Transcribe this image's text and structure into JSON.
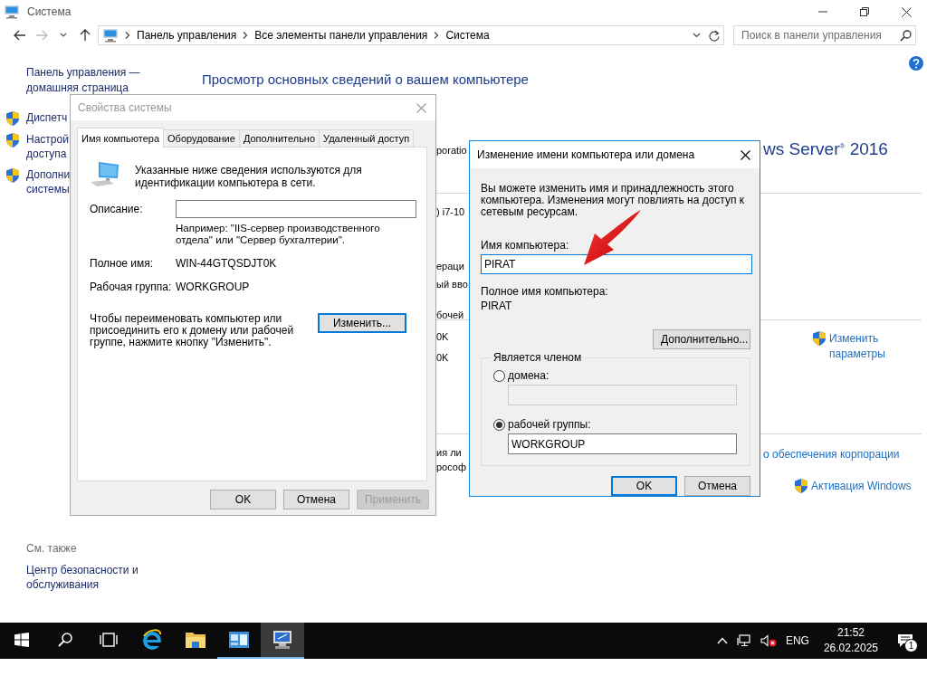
{
  "window": {
    "title": "Система"
  },
  "address_bar": {
    "path": [
      "Панель управления",
      "Все элементы панели управления",
      "Система"
    ]
  },
  "search": {
    "placeholder": "Поиск в панели управления"
  },
  "sidebar": {
    "home_link": "Панель управления — домашняя страница",
    "items": [
      {
        "lines": [
          "Диспетч"
        ]
      },
      {
        "lines": [
          "Настрой",
          "доступа"
        ]
      },
      {
        "lines": [
          "Дополни",
          "системы"
        ]
      }
    ],
    "see_also": {
      "title": "См. также",
      "links": [
        "Центр безопасности и обслуживания"
      ]
    }
  },
  "main": {
    "heading": "Просмотр основных сведений о вашем компьютере",
    "edition": "ws Server$^{®}$ 2016",
    "fragments": [
      "poratio",
      ") i7-10",
      "ераци",
      "ый вво",
      "бочей",
      "0K",
      "0K",
      "ия ли",
      "рософ"
    ],
    "links": [
      {
        "text": "Изменить параметры",
        "shield": true
      },
      {
        "text": "о обеспечения корпорации",
        "shield": false
      },
      {
        "text": "Активация Windows",
        "shield": true
      }
    ]
  },
  "system_properties": {
    "title": "Свойства системы",
    "tabs": [
      {
        "label": "Имя компьютера",
        "selected": true
      },
      {
        "label": "Оборудование",
        "selected": false
      },
      {
        "label": "Дополнительно",
        "selected": false
      },
      {
        "label": "Удаленный доступ",
        "selected": false
      }
    ],
    "intro": "Указанные ниже сведения используются для идентификации компьютера в сети.",
    "description_label": "Описание:",
    "description_hint": "Например: \"IIS-сервер производственного отдела\" или \"Сервер бухгалтерии\".",
    "full_name": {
      "label": "Полное имя:",
      "value": "WIN-44GTQSDJT0K"
    },
    "workgroup": {
      "label": "Рабочая группа:",
      "value": "WORKGROUP"
    },
    "rename_text": "Чтобы переименовать компьютер или присоединить его к домену или рабочей группе, нажмите кнопку \"Изменить\".",
    "change_button": "Изменить...",
    "buttons": [
      {
        "label": "OK",
        "disabled": false
      },
      {
        "label": "Отмена",
        "disabled": false
      },
      {
        "label": "Применить",
        "disabled": true
      }
    ]
  },
  "rename_dialog": {
    "title": "Изменение имени компьютера или домена",
    "intro": "Вы можете изменить имя и принадлежность этого компьютера. Изменения могут повлиять на доступ к сетевым ресурсам.",
    "computer_name": {
      "label": "Имя компьютера:",
      "value": "PIRAT"
    },
    "full_name": {
      "label": "Полное имя компьютера:",
      "value": "PIRAT"
    },
    "more_button": "Дополнительно...",
    "member_of": {
      "title": "Является членом",
      "options": [
        {
          "label": "домена:",
          "selected": false
        },
        {
          "label": "рабочей группы:",
          "selected": true,
          "value": "WORKGROUP"
        }
      ]
    },
    "buttons": [
      {
        "label": "OK",
        "default": true
      },
      {
        "label": "Отмена",
        "default": false
      }
    ]
  },
  "taskbar": {
    "items": [
      {
        "kind": "start",
        "open": false,
        "selected": false
      },
      {
        "kind": "search",
        "open": false,
        "selected": false
      },
      {
        "kind": "taskview",
        "open": false,
        "selected": false
      },
      {
        "kind": "browser",
        "open": false,
        "selected": false
      },
      {
        "kind": "folder",
        "open": false,
        "selected": false
      },
      {
        "kind": "servermanager",
        "open": true,
        "selected": false
      },
      {
        "kind": "system",
        "open": true,
        "selected": true
      }
    ],
    "language": "ENG",
    "time": "21:52",
    "date": "26.02.2025",
    "notifications": "1"
  }
}
